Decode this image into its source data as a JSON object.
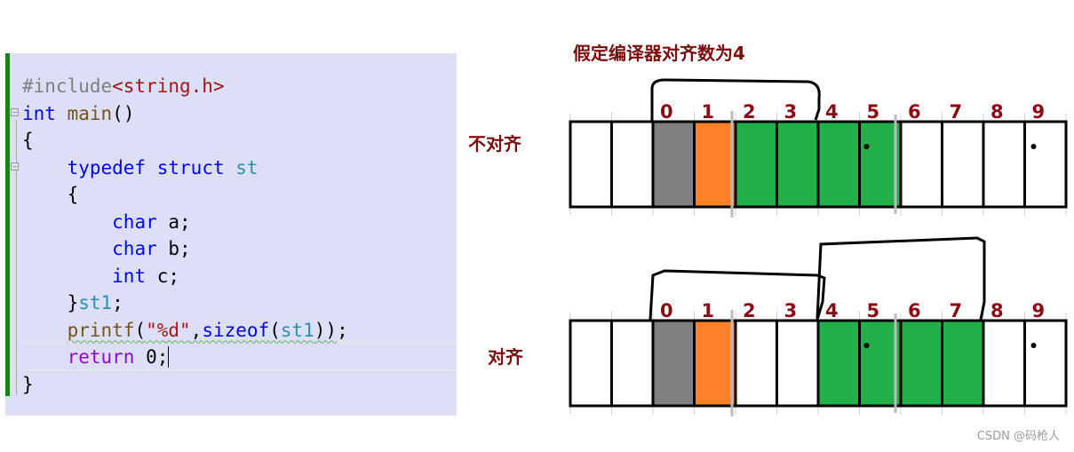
{
  "code_editor": {
    "lines": [
      {
        "tokens": [
          {
            "t": "#include",
            "c": "c-pre"
          },
          {
            "t": "<string.h>",
            "c": "c-inc"
          }
        ],
        "fold": false
      },
      {
        "tokens": [
          {
            "t": "int",
            "c": "c-kw"
          },
          {
            "t": " ",
            "c": "c-plain"
          },
          {
            "t": "main",
            "c": "c-fn"
          },
          {
            "t": "()",
            "c": "c-plain"
          }
        ],
        "fold": true
      },
      {
        "tokens": [
          {
            "t": "{",
            "c": "c-plain"
          }
        ],
        "fold": false
      },
      {
        "tokens": [
          {
            "t": "    ",
            "c": "c-plain"
          },
          {
            "t": "typedef",
            "c": "c-kw"
          },
          {
            "t": " ",
            "c": "c-plain"
          },
          {
            "t": "struct",
            "c": "c-kw"
          },
          {
            "t": " ",
            "c": "c-plain"
          },
          {
            "t": "st",
            "c": "c-type"
          }
        ],
        "fold": true
      },
      {
        "tokens": [
          {
            "t": "    {",
            "c": "c-plain"
          }
        ],
        "fold": false
      },
      {
        "tokens": [
          {
            "t": "        ",
            "c": "c-plain"
          },
          {
            "t": "char",
            "c": "c-kw"
          },
          {
            "t": " a;",
            "c": "c-plain"
          }
        ],
        "fold": false
      },
      {
        "tokens": [
          {
            "t": "        ",
            "c": "c-plain"
          },
          {
            "t": "char",
            "c": "c-kw"
          },
          {
            "t": " b;",
            "c": "c-plain"
          }
        ],
        "fold": false
      },
      {
        "tokens": [
          {
            "t": "        ",
            "c": "c-plain"
          },
          {
            "t": "int",
            "c": "c-kw"
          },
          {
            "t": " c;",
            "c": "c-plain"
          }
        ],
        "fold": false
      },
      {
        "tokens": [
          {
            "t": "    }",
            "c": "c-plain"
          },
          {
            "t": "st1",
            "c": "c-type"
          },
          {
            "t": ";",
            "c": "c-plain"
          }
        ],
        "fold": false
      },
      {
        "tokens": [
          {
            "t": "    ",
            "c": "c-plain"
          },
          {
            "t": "printf",
            "c": "c-fn squiggle"
          },
          {
            "t": "(",
            "c": "c-plain squiggle"
          },
          {
            "t": "\"%d\"",
            "c": "c-str squiggle"
          },
          {
            "t": ",",
            "c": "c-plain squiggle"
          },
          {
            "t": "sizeof",
            "c": "c-kw squiggle"
          },
          {
            "t": "(",
            "c": "c-plain squiggle"
          },
          {
            "t": "st1",
            "c": "c-type squiggle"
          },
          {
            "t": "))",
            "c": "c-plain squiggle"
          },
          {
            "t": ";",
            "c": "c-plain"
          }
        ],
        "fold": false
      },
      {
        "tokens": [
          {
            "t": "    ",
            "c": "c-plain"
          },
          {
            "t": "return",
            "c": "c-ret"
          },
          {
            "t": " 0;",
            "c": "c-plain"
          }
        ],
        "fold": false,
        "caret": true
      },
      {
        "tokens": [
          {
            "t": "}",
            "c": "c-plain"
          }
        ],
        "fold": false
      }
    ]
  },
  "diagram": {
    "title": "假定编译器对齐数为4",
    "colors": {
      "char_a": "#808080",
      "char_b": "#fd8227",
      "int_c": "#22b04b",
      "empty": "#ffffff",
      "index_text": "#8b0a14",
      "label_text": "#7b0d0d"
    },
    "index_labels": [
      "0",
      "1",
      "2",
      "3",
      "4",
      "5",
      "6",
      "7",
      "8",
      "9"
    ],
    "rows": [
      {
        "label": "不对齐",
        "cells": [
          "empty",
          "empty",
          "char_a",
          "char_b",
          "int_c",
          "int_c",
          "int_c",
          "int_c",
          "empty",
          "empty",
          "empty",
          "empty"
        ],
        "bracket_span": [
          "0",
          "3"
        ]
      },
      {
        "label": "对齐",
        "cells": [
          "empty",
          "empty",
          "char_a",
          "char_b",
          "empty",
          "empty",
          "int_c",
          "int_c",
          "int_c",
          "int_c",
          "empty",
          "empty"
        ],
        "bracket_span": [
          "0",
          "7"
        ]
      }
    ]
  },
  "watermark": "CSDN @码枪人"
}
